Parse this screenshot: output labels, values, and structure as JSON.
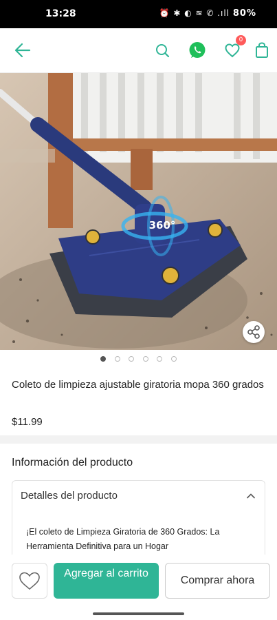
{
  "status_bar": {
    "time": "13:28",
    "indicators": "⏰ ✱ ◐ ≋ ✆ .ıll",
    "battery": "80%"
  },
  "topbar": {
    "icons": [
      "back-arrow-icon",
      "search-icon",
      "whatsapp-icon",
      "wishlist-heart-icon",
      "shopping-bag-icon"
    ],
    "wishlist_count": "0",
    "accent_color": "#2fb596",
    "whatsapp_color": "#1fbf5a"
  },
  "hero": {
    "overlay_text": "360°",
    "carousel_count": 6,
    "carousel_active": 1
  },
  "product": {
    "title": "Coleto de limpieza ajustable giratoria mopa 360 grados",
    "price": "$11.99"
  },
  "info": {
    "section_title": "Información del producto",
    "details_header": "Detalles del producto",
    "details_text": "¡El coleto de Limpieza Giratoria de 360 Grados: La Herramienta Definitiva para un Hogar"
  },
  "actions": {
    "add_to_cart": "Agregar al carrito",
    "buy_now": "Comprar ahora"
  }
}
